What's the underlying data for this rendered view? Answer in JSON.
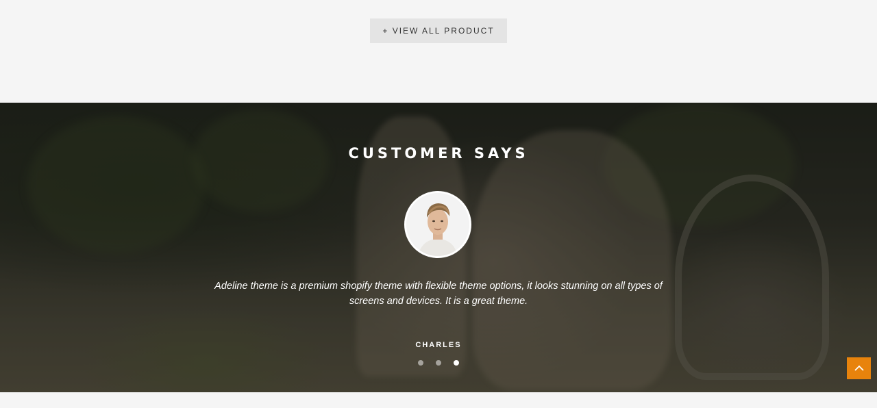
{
  "top": {
    "view_all_label": "+ VIEW ALL PRODUCT"
  },
  "testimonial": {
    "title": "CUSTOMER SAYS",
    "quote": "Adeline theme is a premium shopify theme with flexible theme options, it looks stunning on all types of screens and devices. It is a great theme.",
    "author": "CHARLES",
    "slides": 3,
    "active_slide": 3
  },
  "scroll_top": {
    "icon": "chevron-up-icon",
    "color": "#e8830c"
  },
  "colors": {
    "background": "#f5f5f5",
    "button_bg": "#e4e4e4",
    "accent": "#e8830c"
  }
}
